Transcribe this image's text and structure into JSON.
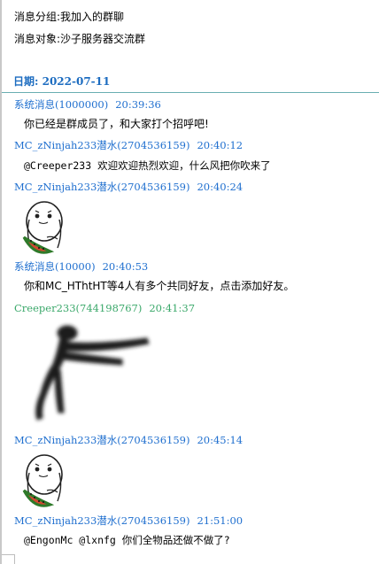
{
  "meta": {
    "group_line": "消息分组:我加入的群聊",
    "target_line": "消息对象:沙子服务器交流群"
  },
  "date_header": "日期: 2022-07-11",
  "colors": {
    "date": "#1c6cc0",
    "sender_blue": "#1f6fcf",
    "sender_green": "#3aa86a",
    "divider": "#69aeb1"
  },
  "messages": [
    {
      "sender": "系统消息(1000000)",
      "time": "20:39:36",
      "text": "你已经是群成员了，和大家打个招呼吧!"
    },
    {
      "sender": "MC_zNinjah233潜水(2704536159)",
      "time": "20:40:12",
      "text": "@Creeper233 欢迎欢迎热烈欢迎，什么风把你吹来了"
    },
    {
      "sender": "MC_zNinjah233潜水(2704536159)",
      "time": "20:40:24",
      "image": "crying-meme-sticker-eating-watermelon"
    },
    {
      "sender": "系统消息(10000)",
      "time": "20:40:53",
      "text": "你和MC_HThtHT等4人有多个共同好友，点击添加好友。"
    },
    {
      "sender": "Creeper233(744198767)",
      "time": "20:41:37",
      "image": "blurry-dark-creature-silhouette-sticker"
    },
    {
      "sender": "MC_zNinjah233潜水(2704536159)",
      "time": "20:45:14",
      "image": "crying-meme-sticker-eating-watermelon"
    },
    {
      "sender": "MC_zNinjah233潜水(2704536159)",
      "time": "21:51:00",
      "text": "@EngonMc @lxnfg 你们全物品还做不做了?"
    }
  ]
}
